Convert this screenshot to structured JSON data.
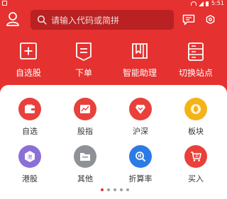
{
  "status_bar": {
    "time": "5:51"
  },
  "header": {
    "search": {
      "placeholder": "请输入代码或简拼"
    }
  },
  "quick_actions": [
    {
      "label": "自选股",
      "icon": "add-square-icon"
    },
    {
      "label": "下单",
      "icon": "order-list-icon"
    },
    {
      "label": "智能助理",
      "icon": "assistant-icon"
    },
    {
      "label": "切换站点",
      "icon": "server-switch-icon"
    }
  ],
  "grid": [
    {
      "label": "自选",
      "icon": "wallet-icon",
      "color": "#e9403b"
    },
    {
      "label": "股指",
      "icon": "chart-icon",
      "color": "#e9403b"
    },
    {
      "label": "沪深",
      "icon": "shield-icon",
      "color": "#e9403b"
    },
    {
      "label": "板块",
      "icon": "coin-icon",
      "color": "#f5b31a"
    },
    {
      "label": "港股",
      "icon": "hk-badge-icon",
      "color": "#8b6fd6"
    },
    {
      "label": "其他",
      "icon": "folder-icon",
      "color": "#8e9297"
    },
    {
      "label": "折算率",
      "icon": "search-doc-icon",
      "color": "#2c7be5"
    },
    {
      "label": "买入",
      "icon": "cart-icon",
      "color": "#e9403b"
    }
  ],
  "pager": {
    "pages": 5,
    "active": 1
  },
  "colors": {
    "brand": "#e5312f",
    "panel": "#ffffff"
  }
}
